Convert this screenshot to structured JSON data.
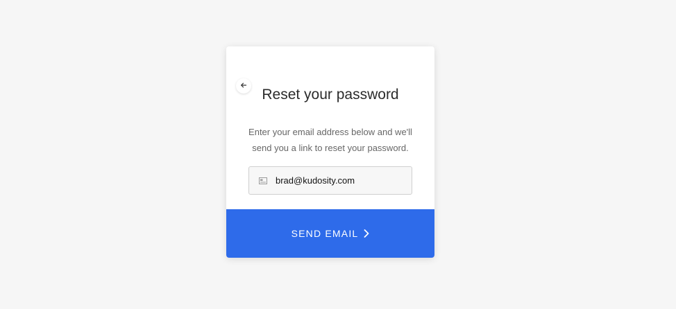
{
  "card": {
    "title": "Reset your password",
    "description": "Enter your email address below and we'll send you a link to reset your password.",
    "back_icon": "arrow-left-icon"
  },
  "email_field": {
    "icon": "id-card-icon",
    "value": "brad@kudosity.com"
  },
  "send_button": {
    "label": "SEND EMAIL",
    "icon": "chevron-right-icon",
    "color": "#2e6bea"
  }
}
